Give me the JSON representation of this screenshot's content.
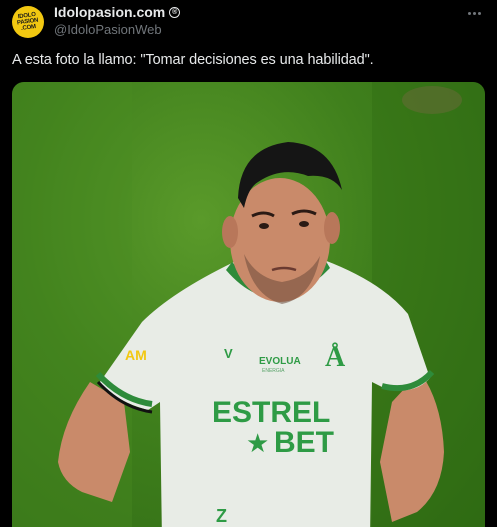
{
  "account": {
    "display_name": "Idolopasion.com",
    "verified_symbol": "®",
    "handle": "@IdoloPasionWeb",
    "avatar_text": [
      "IDOLO",
      "PASION",
      ".COM"
    ]
  },
  "tweet": {
    "text": "A esta foto la llamo: \"Tomar decisiones es una habilidad\"."
  },
  "photo": {
    "shirt_sponsor_line1": "ESTREL",
    "shirt_sponsor_line2": "BET",
    "shirt_partner": "EVOLUA",
    "shirt_partner_sub": "ENERGIA",
    "badge_text": "AM",
    "colors": {
      "grass": "#3f7f1c",
      "shirt": "#e8ece6",
      "trim": "#2e8b3a",
      "sponsor": "#2e9b45",
      "skin": "#c98a6a",
      "hair": "#151515"
    }
  }
}
